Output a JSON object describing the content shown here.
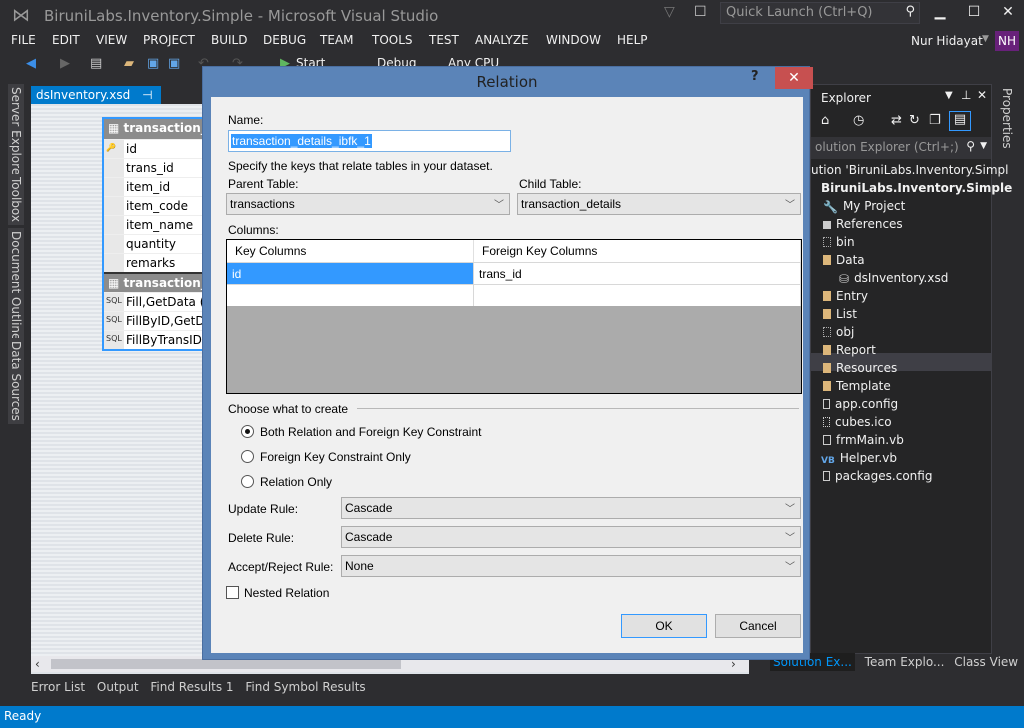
{
  "window": {
    "title": "BiruniLabs.Inventory.Simple - Microsoft Visual Studio",
    "quick_launch_placeholder": "Quick Launch (Ctrl+Q)",
    "minimize": "▁",
    "maximize": "☐",
    "close": "✕"
  },
  "menu": [
    "FILE",
    "EDIT",
    "VIEW",
    "PROJECT",
    "BUILD",
    "DEBUG",
    "TEAM",
    "TOOLS",
    "TEST",
    "ANALYZE",
    "WINDOW",
    "HELP"
  ],
  "user": {
    "name": "Nur Hidayat",
    "initials": "NH",
    "avatar_color": "#68217a"
  },
  "toolbar": {
    "start": "Start",
    "config": "Debug",
    "platform": "Any CPU"
  },
  "left_rail": [
    "Server Explorer",
    "Toolbox",
    "Document Outline",
    "Data Sources"
  ],
  "document_tab": {
    "label": "dsInventory.xsd",
    "pin": "⊣",
    "close": "✕"
  },
  "designer": {
    "table": {
      "name": "transaction_details",
      "header_visible": "transaction_d",
      "columns": [
        "id",
        "trans_id",
        "item_id",
        "item_code",
        "item_name",
        "quantity",
        "remarks"
      ],
      "key_column": "id"
    },
    "adapter": {
      "header_visible": "transaction_d",
      "queries": [
        "Fill,GetData ()",
        "FillByID,GetDat",
        "FillByTransID,G"
      ]
    }
  },
  "solution_explorer": {
    "title": "Solution Explorer",
    "title_visible": "Explorer",
    "search_placeholder": "olution Explorer (Ctrl+;)",
    "items": [
      {
        "label": "ution 'BiruniLabs.Inventory.Simpl",
        "icon": "solution"
      },
      {
        "label": "BiruniLabs.Inventory.Simple",
        "icon": "project",
        "bold": true
      },
      {
        "label": "My Project",
        "icon": "wrench"
      },
      {
        "label": "References",
        "icon": "references"
      },
      {
        "label": "bin",
        "icon": "folder-hidden"
      },
      {
        "label": "Data",
        "icon": "folder"
      },
      {
        "label": "dsInventory.xsd",
        "icon": "dataset",
        "selected": true
      },
      {
        "label": "Entry",
        "icon": "folder"
      },
      {
        "label": "List",
        "icon": "folder"
      },
      {
        "label": "obj",
        "icon": "folder-hidden"
      },
      {
        "label": "Report",
        "icon": "folder"
      },
      {
        "label": "Resources",
        "icon": "folder"
      },
      {
        "label": "Template",
        "icon": "folder"
      },
      {
        "label": "app.config",
        "icon": "file"
      },
      {
        "label": "cubes.ico",
        "icon": "icon-file"
      },
      {
        "label": "frmMain.vb",
        "icon": "form"
      },
      {
        "label": "Helper.vb",
        "icon": "vb"
      },
      {
        "label": "packages.config",
        "icon": "file"
      }
    ],
    "bottom_tabs": [
      "Solution Ex...",
      "Team Explo...",
      "Class View"
    ]
  },
  "properties_tab": "Properties",
  "output_tabs": [
    "Error List",
    "Output",
    "Find Results 1",
    "Find Symbol Results"
  ],
  "status": "Ready",
  "dialog": {
    "title": "Relation",
    "help": "?",
    "close": "✕",
    "name_label": "Name:",
    "name_value": "transaction_details_ibfk_1",
    "instructions": "Specify the keys that relate tables in your dataset.",
    "parent_label": "Parent Table:",
    "parent_value": "transactions",
    "child_label": "Child Table:",
    "child_value": "transaction_details",
    "columns_label": "Columns:",
    "grid": {
      "headers": [
        "Key Columns",
        "Foreign Key Columns"
      ],
      "rows": [
        [
          "id",
          "trans_id"
        ],
        [
          "",
          ""
        ]
      ]
    },
    "create_group": "Choose what to create",
    "radios": [
      {
        "label": "Both Relation and Foreign Key Constraint",
        "checked": true
      },
      {
        "label": "Foreign Key Constraint Only",
        "checked": false
      },
      {
        "label": "Relation Only",
        "checked": false
      }
    ],
    "update_label": "Update Rule:",
    "update_value": "Cascade",
    "delete_label": "Delete Rule:",
    "delete_value": "Cascade",
    "accept_label": "Accept/Reject Rule:",
    "accept_value": "None",
    "nested_label": "Nested Relation",
    "nested_checked": false,
    "ok": "OK",
    "cancel": "Cancel"
  }
}
